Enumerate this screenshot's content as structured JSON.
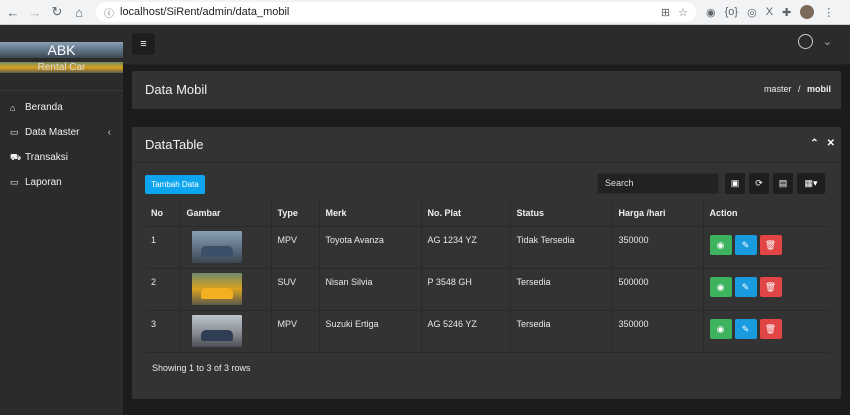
{
  "browser": {
    "url": "localhost/SiRent/admin/data_mobil",
    "back_icon": "←",
    "forward_icon": "→",
    "reload_icon": "↻",
    "home_icon": "⌂",
    "lock_icon": "ⓘ",
    "translate_icon": "⊞",
    "star_icon": "☆",
    "camera_icon": "◉",
    "ext_icon": "{o}",
    "globe_icon": "◎",
    "x_icon": "X",
    "puzzle_icon": "✚",
    "menu_icon": "⋮"
  },
  "sidebar": {
    "brand_title": "ABK",
    "brand_subtitle": "Rental Car",
    "items": [
      {
        "label": "Beranda",
        "icon": "⌂"
      },
      {
        "label": "Data Master",
        "icon": "▭",
        "chev": "‹"
      },
      {
        "label": "Transaksi",
        "icon": "⛟"
      },
      {
        "label": "Laporan",
        "icon": "▭"
      }
    ]
  },
  "topbar": {
    "hamburger": "≡",
    "user_chevron": "⌄"
  },
  "page": {
    "title": "Data Mobil",
    "breadcrumb_master": "master",
    "breadcrumb_sep": "/",
    "breadcrumb_current": "mobil"
  },
  "card": {
    "title": "DataTable",
    "collapse_icon": "⌃",
    "close_icon": "✕",
    "add_button": "Tambah Data",
    "search_placeholder": "Search",
    "toolbar": {
      "paginate_icon": "▣",
      "refresh_icon": "⟳",
      "export_icon": "▤",
      "columns_icon": "▦▾"
    },
    "columns": [
      "No",
      "Gambar",
      "Type",
      "Merk",
      "No. Plat",
      "Status",
      "Harga /hari",
      "Action"
    ],
    "rows": [
      {
        "no": "1",
        "type": "MPV",
        "merk": "Toyota Avanza",
        "plat": "AG 1234 YZ",
        "status": "Tidak Tersedia",
        "harga": "350000"
      },
      {
        "no": "2",
        "type": "SUV",
        "merk": "Nisan Silvia",
        "plat": "P 3548 GH",
        "status": "Tersedia",
        "harga": "500000"
      },
      {
        "no": "3",
        "type": "MPV",
        "merk": "Suzuki Ertiga",
        "plat": "AG 5246 YZ",
        "status": "Tersedia",
        "harga": "350000"
      }
    ],
    "action_icons": {
      "view": "◉",
      "edit": "✎",
      "delete": "🗑"
    },
    "footer": "Showing 1 to 3 of 3 rows"
  },
  "colors": {
    "accent": "#0ea5f0",
    "view": "#3cb35c",
    "edit": "#1a9be0",
    "delete": "#e24545"
  }
}
